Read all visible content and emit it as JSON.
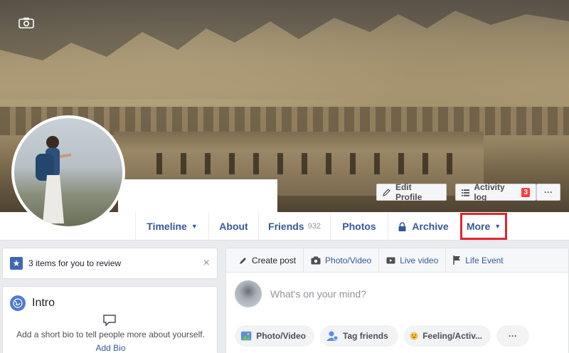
{
  "cover": {
    "camera_icon": "camera-icon",
    "edit_profile_label": "Edit Profile",
    "activity_log_label": "Activity log",
    "activity_log_badge": "3",
    "more_dots": "···"
  },
  "nav": {
    "timeline": "Timeline",
    "about": "About",
    "friends": "Friends",
    "friends_count": "932",
    "photos": "Photos",
    "archive": "Archive",
    "more": "More",
    "caret": "▼"
  },
  "review": {
    "text": "3 items for you to review",
    "close": "×"
  },
  "intro": {
    "title": "Intro",
    "bio_prompt": "Add a short bio to tell people more about yourself.",
    "add_bio": "Add Bio"
  },
  "composer": {
    "tabs": [
      "Create post",
      "Photo/Video",
      "Live video",
      "Life Event"
    ],
    "placeholder": "What's on your mind?",
    "actions": [
      "Photo/Video",
      "Tag friends",
      "Feeling/Activ...",
      "···"
    ]
  },
  "colors": {
    "link_blue": "#365899",
    "brand_blue": "#4267b2",
    "highlight_red": "#e0262e",
    "badge_red": "#fa3e3e"
  }
}
